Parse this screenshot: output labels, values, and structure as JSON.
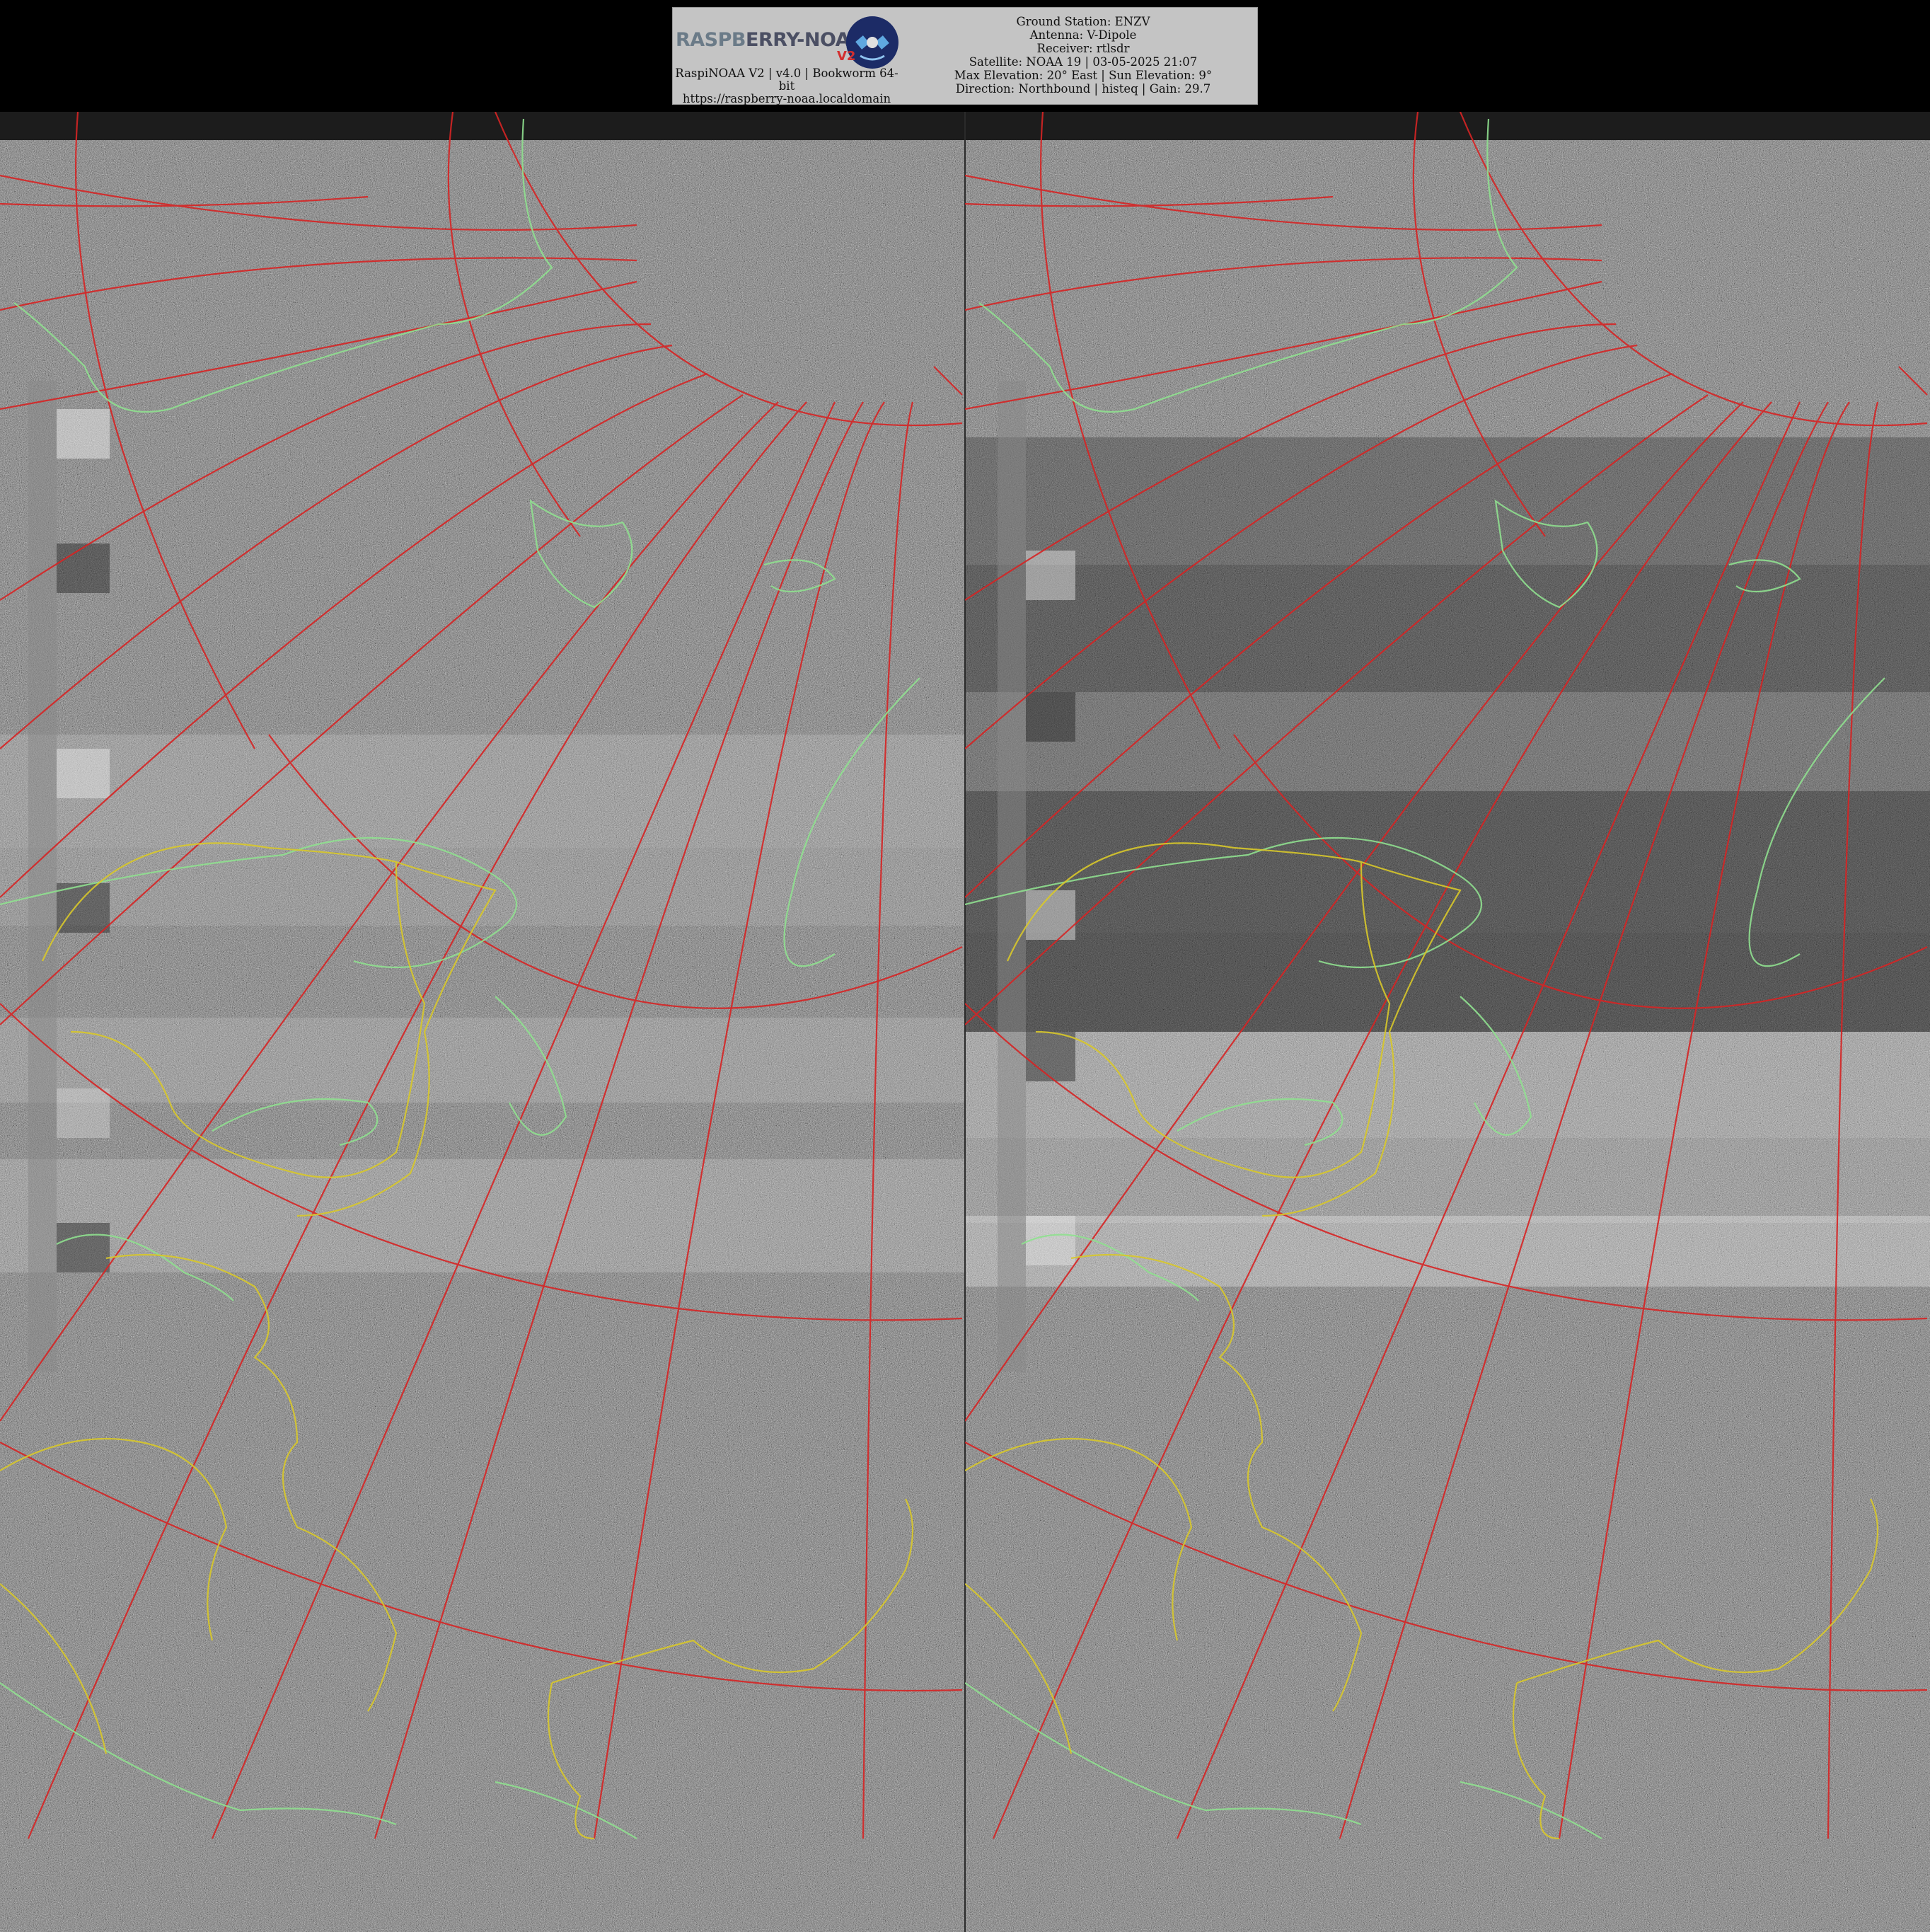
{
  "overlay": {
    "logo": {
      "wordmark_part1": "RASPB",
      "wordmark_part2": "ERRY-NOAA",
      "version_badge": "V2",
      "caption_line1": "RaspiNOAA V2 | v4.0 | Bookworm 64-",
      "caption_line2": "bit",
      "caption_line3": "https://raspberry-noaa.localdomain"
    },
    "lines": [
      "Ground Station: ENZV",
      "Antenna: V-Dipole",
      "Receiver: rtlsdr",
      "Satellite: NOAA 19 | 03-05-2025 21:07",
      "Max Elevation: 20° East | Sun Elevation: 9°",
      "Direction: Northbound | histeq | Gain: 29.7"
    ]
  },
  "colors": {
    "background": "#000000",
    "panel": "#c4c4c4",
    "graticule": "#d62424",
    "coastline": "#8fe08f",
    "borders": "#d8c82a",
    "noise_gray": "#7a7a7a"
  },
  "image": {
    "description_channels": [
      "channel-a",
      "channel-b"
    ]
  }
}
